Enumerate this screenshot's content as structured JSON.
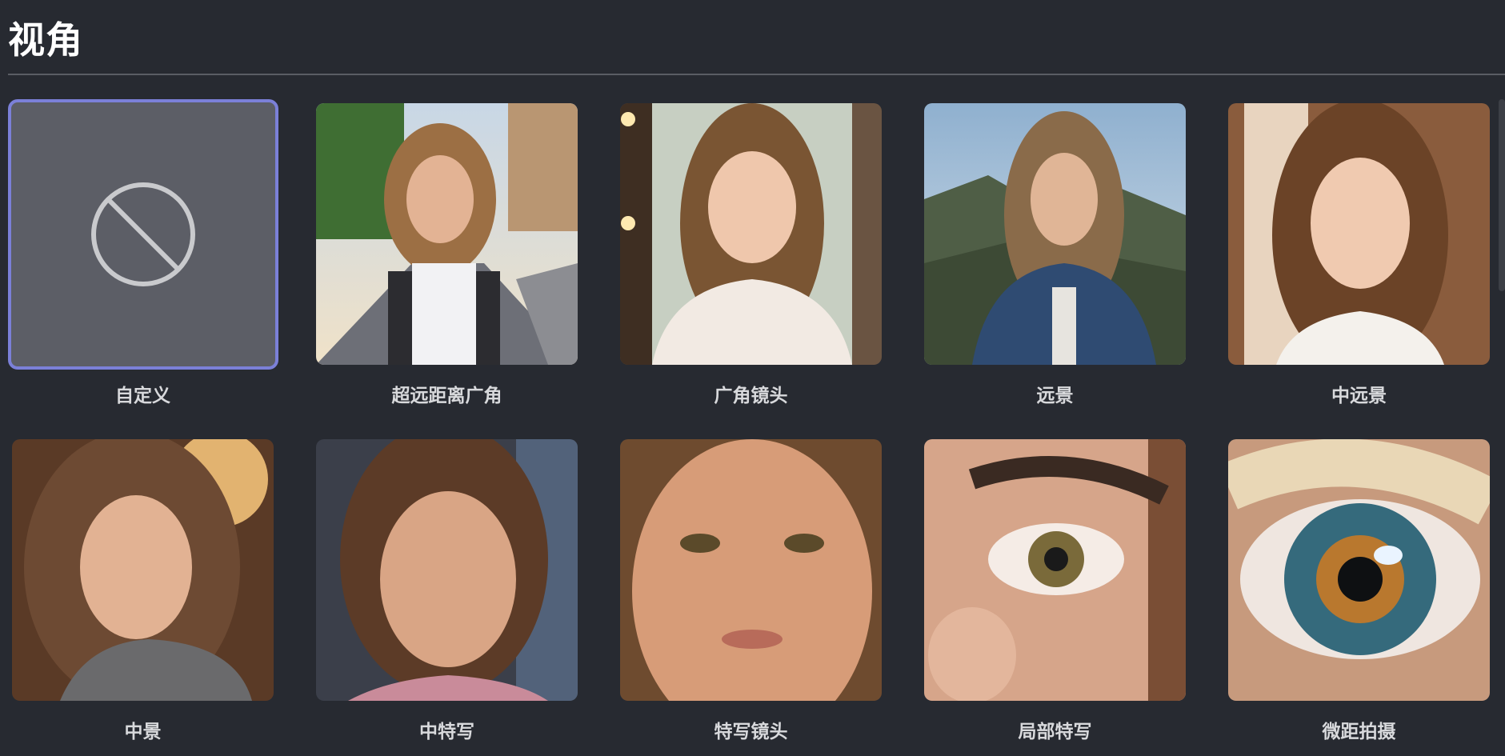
{
  "section": {
    "title": "视角"
  },
  "cards": [
    {
      "label": "自定义",
      "icon": "disabled-icon",
      "selected": true
    },
    {
      "label": "超远距离广角",
      "image": "girl-street-wide-angle-selfie"
    },
    {
      "label": "广角镜头",
      "image": "girl-white-lace-dress-window"
    },
    {
      "label": "远景",
      "image": "girl-denim-jacket-mountains"
    },
    {
      "label": "中远景",
      "image": "girl-braided-hair-portrait"
    },
    {
      "label": "中景",
      "image": "girl-curly-hair-grey-sweater"
    },
    {
      "label": "中特写",
      "image": "girl-face-medium-closeup"
    },
    {
      "label": "特写镜头",
      "image": "girl-face-closeup"
    },
    {
      "label": "局部特写",
      "image": "eye-and-nose-detail"
    },
    {
      "label": "微距拍摄",
      "image": "eye-macro"
    }
  ],
  "colors": {
    "background": "#272a31",
    "selected_border": "#7b80d8",
    "custom_tile": "#5c5e66"
  }
}
